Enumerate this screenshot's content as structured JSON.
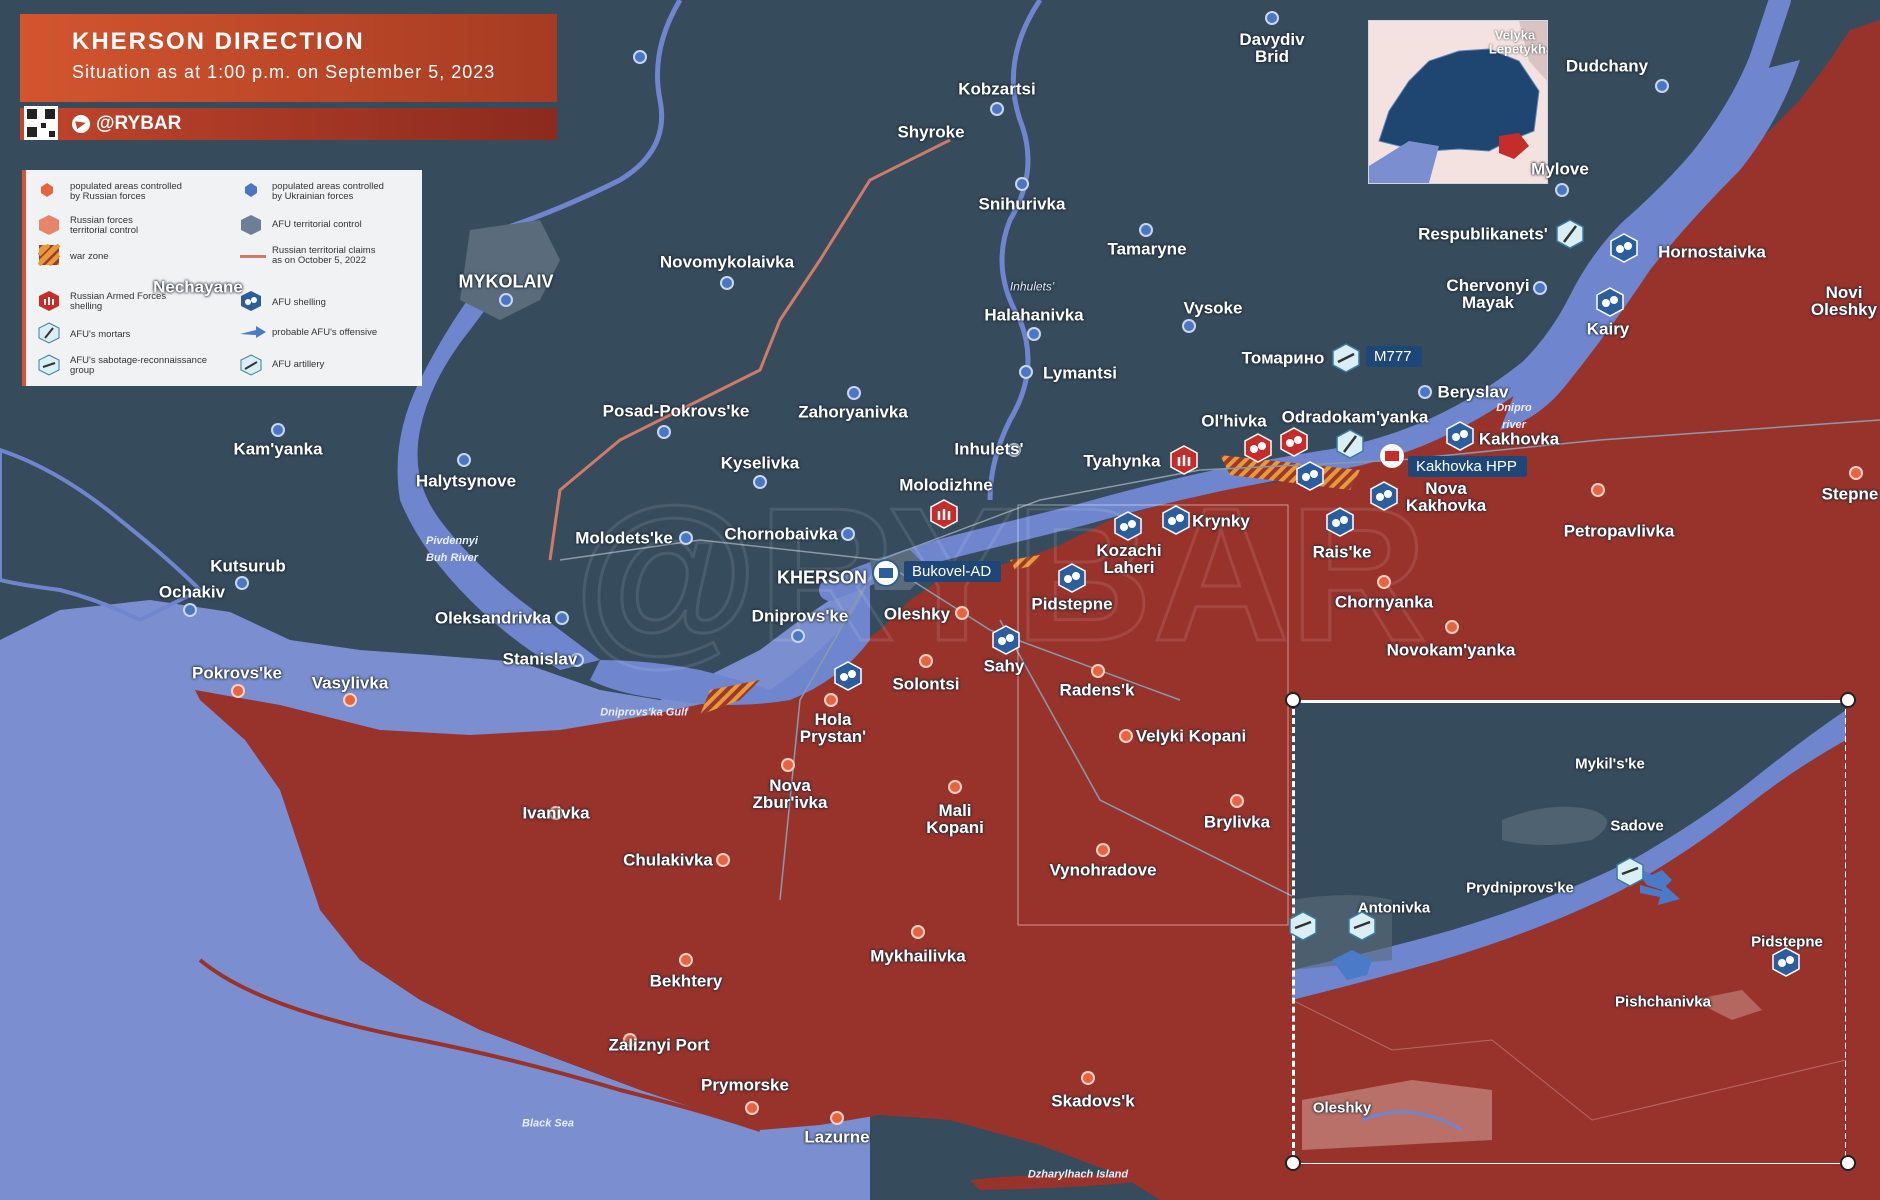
{
  "header": {
    "title": "KHERSON DIRECTION",
    "subtitle": "Situation as at 1:00 p.m. on September 5, 2023"
  },
  "brand": {
    "handle": "@RYBAR"
  },
  "colors": {
    "land_ua": "#364b5c",
    "land_ru": "#98332c",
    "water": "#7b8fd0",
    "river": "#6f86cf",
    "accent": "#d3552f",
    "afu_icon": "#2c5d9d",
    "ru_icon": "#c62d2a"
  },
  "legend": {
    "items": [
      {
        "icon": "russian-populated-area-icon",
        "label": "populated areas controlled\nby Russian forces"
      },
      {
        "icon": "ukrainian-populated-area-icon",
        "label": "populated areas controlled\nby Ukrainian forces"
      },
      {
        "icon": "russian-territory-icon",
        "label": "Russian forces\nterritorial control"
      },
      {
        "icon": "afu-territory-icon",
        "label": "AFU territorial control"
      },
      {
        "icon": "war-zone-icon",
        "label": "war zone"
      },
      {
        "icon": "russian-claims-line-icon",
        "label": "Russian territorial claims\nas on October 5, 2022"
      },
      {
        "icon": "russian-shelling-icon",
        "label": "Russian Armed Forces\nshelling"
      },
      {
        "icon": "afu-shelling-icon",
        "label": "AFU shelling"
      },
      {
        "icon": "afu-mortar-icon",
        "label": "AFU's mortars"
      },
      {
        "icon": "afu-offensive-arrow-icon",
        "label": "probable AFU's offensive"
      },
      {
        "icon": "afu-sabotage-group-icon",
        "label": "AFU's sabotage-reconnaissance\ngroup"
      },
      {
        "icon": "afu-artillery-icon",
        "label": "AFU artillery"
      }
    ]
  },
  "places_ua": [
    "Davydiv\nBrid",
    "Kobzartsi",
    "Shyroke",
    "Snihurivka",
    "Tamaryne",
    "Novomykolaivka",
    "Inhulets'",
    "Halahanivka",
    "Vysoke",
    "Томарино",
    "Lymantsi",
    "MYKOLAIV",
    "Nechayane",
    "Kam'yanka",
    "Posad-Pokrovs'ke",
    "Zahoryanivka",
    "Halytsynove",
    "Kyselivka",
    "Inhulets'",
    "Molodizhne",
    "Chornobaivka",
    "Molodets'ke",
    "Kutsurub",
    "Ochakiv",
    "KHERSON",
    "Oleksandrivka",
    "Dniprovs'ke",
    "Stanislav",
    "Ol'hivka",
    "Odradokam'yanka",
    "Tyahynka",
    "Kozachi\nLaheri",
    "Krynky",
    "Beryslav",
    "Respublikanets'",
    "Chervonyi\nMayak",
    "Mylove",
    "Dudchany"
  ],
  "places_ru": [
    "Hornostaivka",
    "Kairy",
    "Novi\nOleshky",
    "Kakhovka",
    "Nova\nKakhovka",
    "Rais'ke",
    "Stepne",
    "Petropavlivka",
    "Chornyanka",
    "Novokam'yanka",
    "Pidstepne",
    "Oleshky",
    "Sahy",
    "Solontsi",
    "Radens'k",
    "Hola\nPrystan'",
    "Velyki Kopani",
    "Pokrovs'ke",
    "Vasylivka",
    "Nova\nZbur'ivka",
    "Mali\nKopani",
    "Brylivka",
    "Ivanivka",
    "Chulakivka",
    "Vynohradove",
    "Mykhailivka",
    "Bekhtery",
    "Zaliznyi Port",
    "Prymorske",
    "Lazurne",
    "Skadovs'k"
  ],
  "water_labels": [
    "Dniprovs'ka Gulf",
    "Black Sea",
    "Dzharylhach Island",
    "Pivdennyi\nBuh River",
    "Dnipro\nriver"
  ],
  "tags": {
    "m777": "M777",
    "hpp": "Kakhovka HPP",
    "bukovel": "Bukovel-AD"
  },
  "inset_map": {
    "labels": [
      "Velyka",
      "Lepetykha"
    ]
  },
  "zoom_inset": {
    "labels": [
      "Mykil's'ke",
      "Sadove",
      "Prydniprovs'ke",
      "Antonivka",
      "Pidstepne",
      "Pishchanivka",
      "Oleshky"
    ]
  }
}
